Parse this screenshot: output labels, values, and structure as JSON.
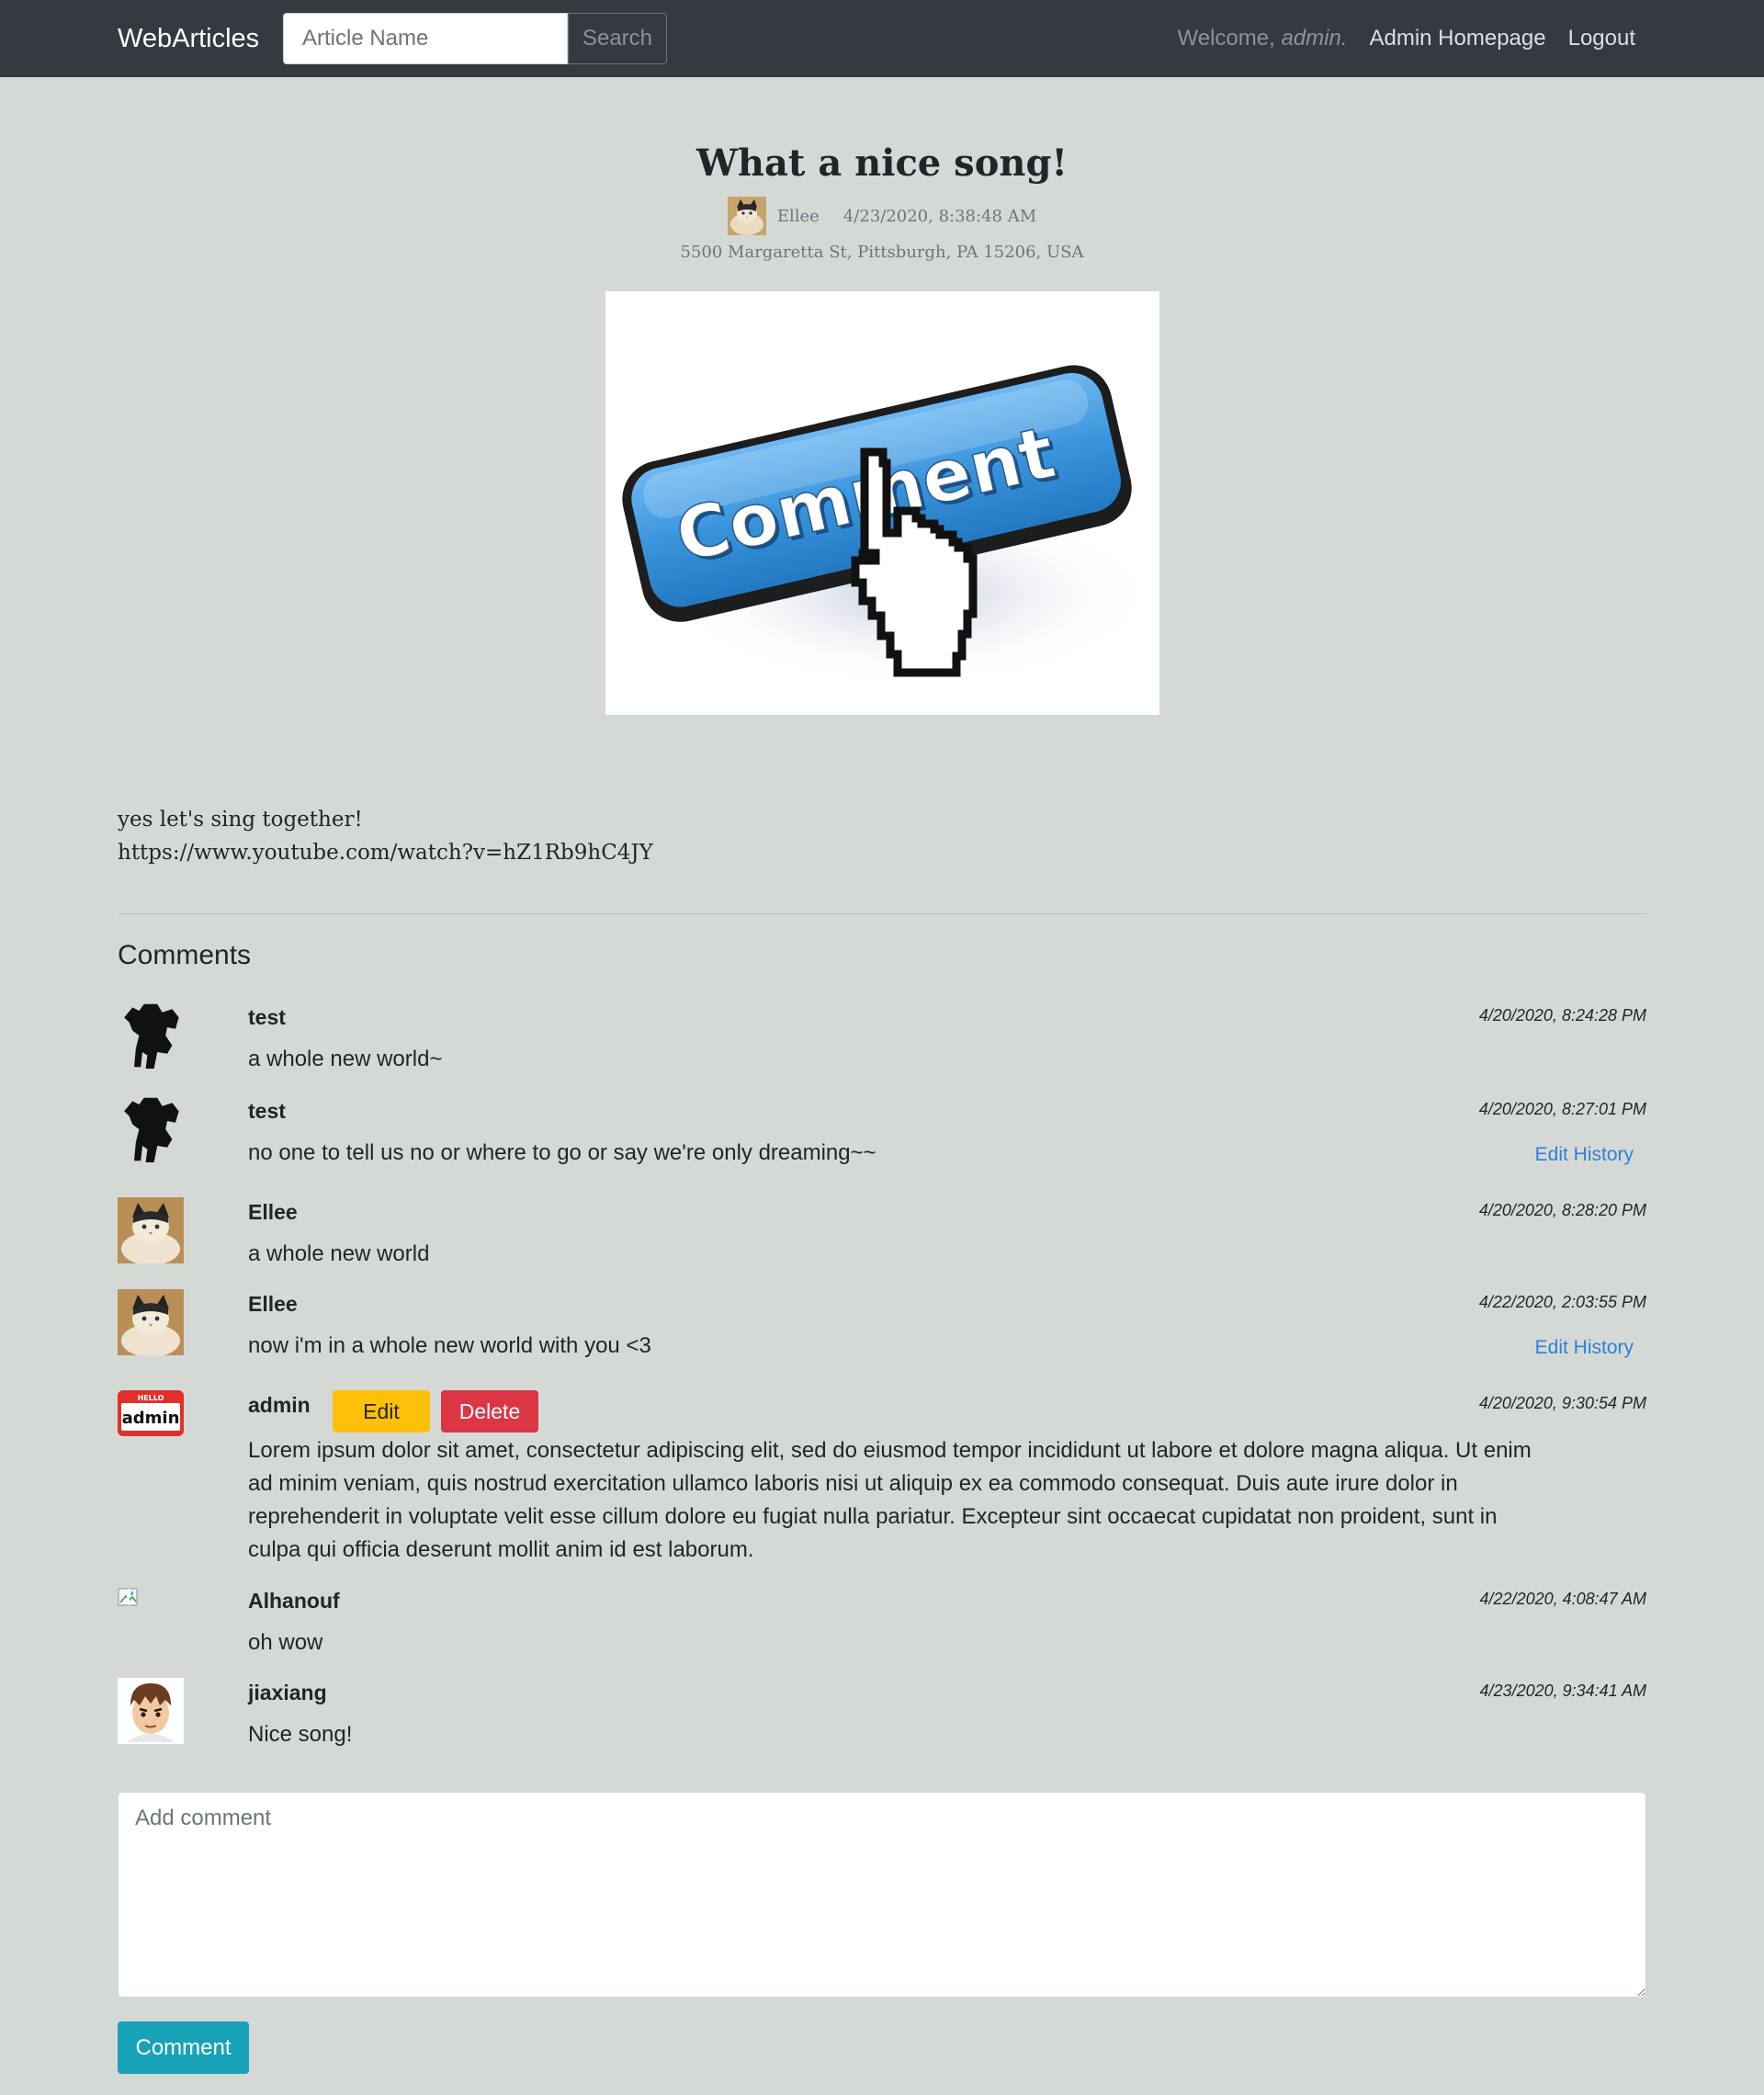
{
  "navbar": {
    "brand": "WebArticles",
    "search_placeholder": "Article Name",
    "search_label": "Search",
    "welcome_prefix": "Welcome, ",
    "welcome_user": "admin.",
    "admin_homepage": "Admin Homepage",
    "logout": "Logout"
  },
  "article": {
    "title": "What a nice song!",
    "author": "Ellee",
    "date": "4/23/2020, 8:38:48 AM",
    "address": "5500 Margaretta St, Pittsburgh, PA 15206, USA",
    "image_text": "Comment",
    "body_line1": "yes let's sing together!",
    "body_line2": "https://www.youtube.com/watch?v=hZ1Rb9hC4JY"
  },
  "comments_section": {
    "heading": "Comments",
    "items": [
      {
        "author": "test",
        "text": "a whole new world~",
        "time": "4/20/2020, 8:24:28 PM",
        "avatar": "strongman-silhouette-icon"
      },
      {
        "author": "test",
        "text": "no one to tell us no or where to go or say we're only dreaming~~",
        "time": "4/20/2020, 8:27:01 PM",
        "edit_history": "Edit History",
        "avatar": "strongman-silhouette-icon"
      },
      {
        "author": "Ellee",
        "text": "a whole new world",
        "time": "4/20/2020, 8:28:20 PM",
        "avatar": "cat-photo-icon"
      },
      {
        "author": "Ellee",
        "text": "now i'm in a whole new world with you <3",
        "time": "4/22/2020, 2:03:55 PM",
        "edit_history": "Edit History",
        "avatar": "cat-photo-icon"
      },
      {
        "author": "admin",
        "text": "Lorem ipsum dolor sit amet, consectetur adipiscing elit, sed do eiusmod tempor incididunt ut labore et dolore magna aliqua. Ut enim ad minim veniam, quis nostrud exercitation ullamco laboris nisi ut aliquip ex ea commodo consequat. Duis aute irure dolor in reprehenderit in voluptate velit esse cillum dolore eu fugiat nulla pariatur. Excepteur sint occaecat cupidatat non proident, sunt in culpa qui officia deserunt mollit anim id est laborum.",
        "time": "4/20/2020, 9:30:54 PM",
        "edit_label": "Edit",
        "delete_label": "Delete",
        "avatar": "hello-admin-badge-icon",
        "badge_top": "HELLO",
        "badge_name": "admin"
      },
      {
        "author": "Alhanouf",
        "text": "oh wow",
        "time": "4/22/2020, 4:08:47 AM",
        "avatar": "broken-image-icon"
      },
      {
        "author": "jiaxiang",
        "text": "Nice song!",
        "time": "4/23/2020, 9:34:41 AM",
        "avatar": "cartoon-boy-icon"
      }
    ]
  },
  "add_comment": {
    "placeholder": "Add comment",
    "submit_label": "Comment"
  },
  "colors": {
    "page_bg": "#d5d9d6",
    "navbar_bg": "#343a40",
    "edit_button": "#ffc107",
    "delete_button": "#dc3545",
    "comment_button": "#17a2b8",
    "link": "#2f7fd8"
  }
}
